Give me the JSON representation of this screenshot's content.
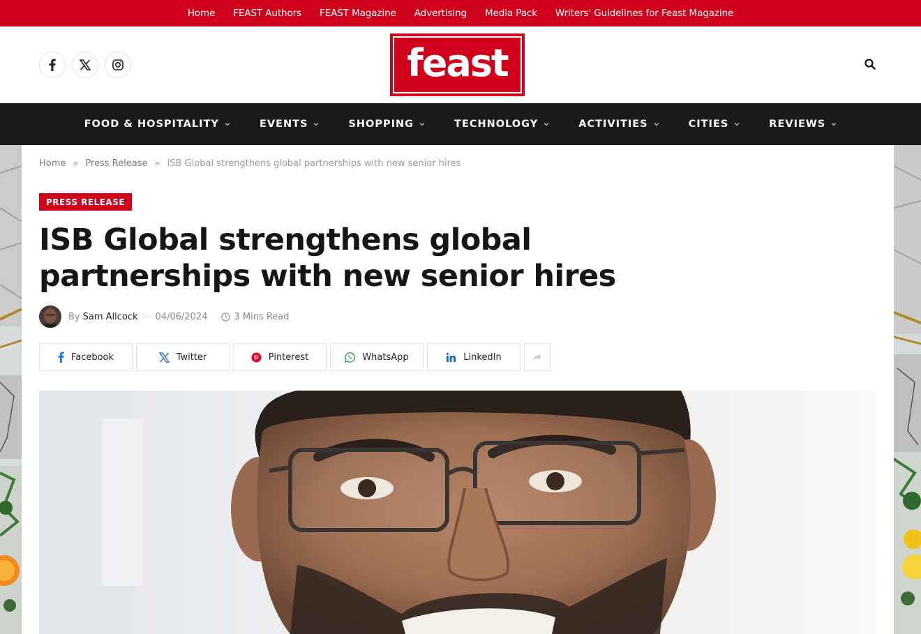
{
  "topbar": {
    "links": [
      "Home",
      "FEAST Authors",
      "FEAST Magazine",
      "Advertising",
      "Media Pack",
      "Writers' Guidelines for Feast Magazine"
    ]
  },
  "header": {
    "logo_text": "feast",
    "socials": [
      "facebook-icon",
      "x-icon",
      "instagram-icon"
    ],
    "search_icon": "search-icon"
  },
  "nav": {
    "items": [
      "FOOD & HOSPITALITY",
      "EVENTS",
      "SHOPPING",
      "TECHNOLOGY",
      "ACTIVITIES",
      "CITIES",
      "REVIEWS"
    ]
  },
  "breadcrumb": {
    "home": "Home",
    "sep": "»",
    "section": "Press Release",
    "current": "ISB Global strengthens global partnerships with new senior hires"
  },
  "article": {
    "category": "PRESS RELEASE",
    "title": "ISB Global strengthens global partnerships with new senior hires",
    "by": "By",
    "author": "Sam Allcock",
    "dash": "—",
    "date": "04/06/2024",
    "read_time": "3 Mins Read"
  },
  "share": {
    "facebook": "Facebook",
    "twitter": "Twitter",
    "pinterest": "Pinterest",
    "whatsapp": "WhatsApp",
    "linkedin": "LinkedIn"
  },
  "colors": {
    "brand_red": "#d0021b",
    "nav_bg": "#1a1a1a"
  }
}
